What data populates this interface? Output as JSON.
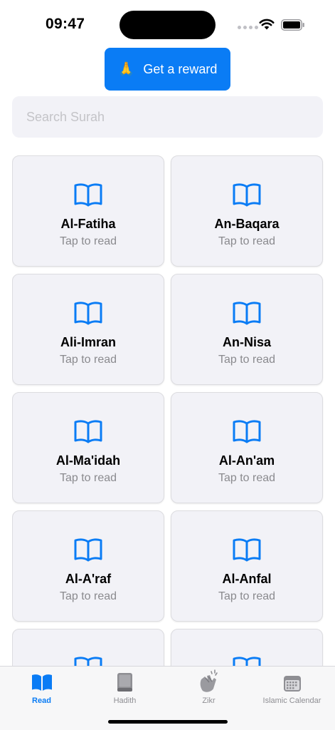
{
  "status_bar": {
    "time": "09:47"
  },
  "reward_button": {
    "emoji": "🙏",
    "label": "Get a reward"
  },
  "search": {
    "placeholder": "Search Surah",
    "value": ""
  },
  "surahs": [
    {
      "name": "Al-Fatiha",
      "subtitle": "Tap to read",
      "icon": "book-open-icon"
    },
    {
      "name": "An-Baqara",
      "subtitle": "Tap to read",
      "icon": "book-open-icon"
    },
    {
      "name": "Ali-Imran",
      "subtitle": "Tap to read",
      "icon": "book-open-icon"
    },
    {
      "name": "An-Nisa",
      "subtitle": "Tap to read",
      "icon": "book-open-icon"
    },
    {
      "name": "Al-Ma'idah",
      "subtitle": "Tap to read",
      "icon": "book-open-icon"
    },
    {
      "name": "Al-An'am",
      "subtitle": "Tap to read",
      "icon": "book-open-icon"
    },
    {
      "name": "Al-A'raf",
      "subtitle": "Tap to read",
      "icon": "book-open-icon"
    },
    {
      "name": "Al-Anfal",
      "subtitle": "Tap to read",
      "icon": "book-open-icon"
    },
    {
      "name": "",
      "subtitle": "",
      "icon": "book-open-icon"
    },
    {
      "name": "",
      "subtitle": "",
      "icon": "book-open-icon"
    }
  ],
  "tabs": [
    {
      "label": "Read",
      "icon": "book-open-icon",
      "active": true
    },
    {
      "label": "Hadith",
      "icon": "book-closed-icon",
      "active": false
    },
    {
      "label": "Zikr",
      "icon": "hands-clapping-icon",
      "active": false
    },
    {
      "label": "Islamic Calendar",
      "icon": "calendar-icon",
      "active": false
    }
  ],
  "colors": {
    "accent": "#0A7CF5",
    "card_bg": "#F2F2F7",
    "muted_text": "#8A8A8E",
    "inactive_tab": "#8E8E93"
  }
}
